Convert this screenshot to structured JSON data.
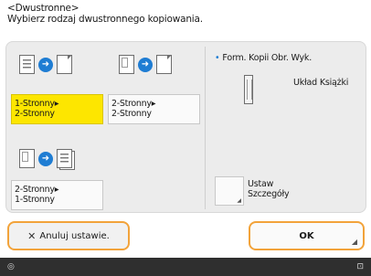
{
  "header": {
    "line1": "<Dwustronne>",
    "line2": "Wybierz rodzaj dwustronnego kopiowania."
  },
  "options": [
    {
      "line1": "1-Stronny▸",
      "line2": "2-Stronny",
      "selected": true
    },
    {
      "line1": "2-Stronny▸",
      "line2": "2-Stronny",
      "selected": false
    },
    {
      "line1": "2-Stronny▸",
      "line2": "1-Stronny",
      "selected": false
    }
  ],
  "format": {
    "label": "Form. Kopii Obr. Wyk.",
    "value": "Układ Książki"
  },
  "details": {
    "line1": "Ustaw",
    "line2": "Szczegóły"
  },
  "buttons": {
    "cancel": "Anuluj ustawie.",
    "ok": "OK"
  },
  "colors": {
    "selected": "#fde600",
    "focus_border": "#f2a33a",
    "arrow": "#1f7dd3",
    "status_bar": "#2f2f2f"
  },
  "icons": {
    "arrow": "right-arrow-icon",
    "close": "close-icon",
    "corner": "corner-indicator-icon",
    "status_left": "circle-icon",
    "status_right": "monitor-icon"
  },
  "status": {
    "left_icon": "◎",
    "right_icon": "⊡"
  }
}
